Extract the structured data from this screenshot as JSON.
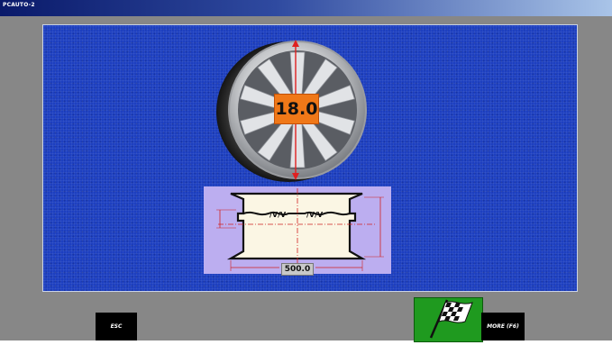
{
  "window": {
    "title": "PCAUTO-2"
  },
  "wheel": {
    "diameter_value": "18.0"
  },
  "profile": {
    "width_value": "500.0"
  },
  "buttons": {
    "esc_label": "ESC",
    "more_label": "MORE (F6)"
  },
  "colors": {
    "panel_blue": "#1d3fc0",
    "measure_orange": "#f07818",
    "profile_lavender": "#bcaef0",
    "go_green": "#1f9a1f"
  },
  "icons": {
    "go": "checkered-flag-icon"
  }
}
